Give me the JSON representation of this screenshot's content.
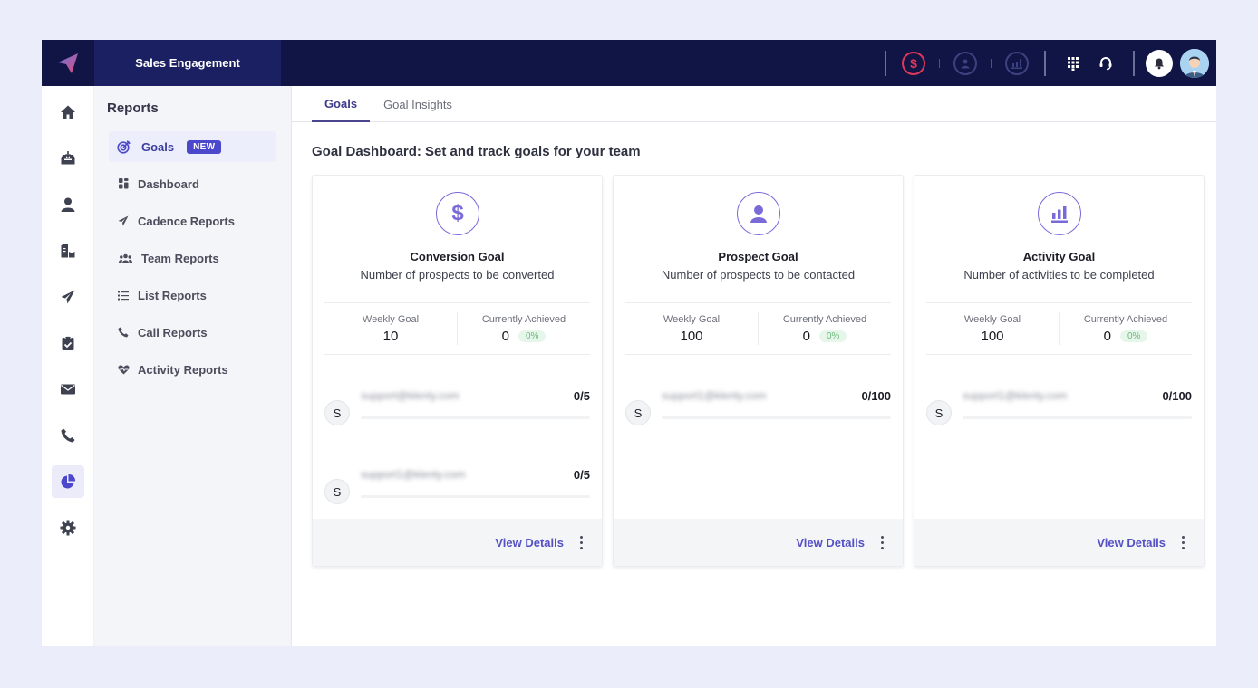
{
  "topbar": {
    "app_name": "Sales Engagement",
    "icons": [
      "conversion-goal-icon",
      "prospect-goal-icon",
      "activity-goal-icon",
      "dialpad-icon",
      "headset-icon",
      "bell-icon",
      "user-avatar"
    ]
  },
  "rail": {
    "items": [
      "home",
      "inbox",
      "prospects",
      "accounts",
      "cadences",
      "tasks",
      "email",
      "calls",
      "reports",
      "settings"
    ],
    "active": "reports"
  },
  "submenu": {
    "title": "Reports",
    "items": [
      {
        "label": "Goals",
        "badge": "NEW",
        "icon": "target-icon",
        "active": true
      },
      {
        "label": "Dashboard",
        "icon": "dashboard-icon"
      },
      {
        "label": "Cadence Reports",
        "icon": "paper-plane-icon"
      },
      {
        "label": "Team Reports",
        "icon": "team-icon"
      },
      {
        "label": "List Reports",
        "icon": "list-icon"
      },
      {
        "label": "Call Reports",
        "icon": "phone-icon"
      },
      {
        "label": "Activity Reports",
        "icon": "heartbeat-icon"
      }
    ]
  },
  "tabs": [
    {
      "label": "Goals",
      "active": true
    },
    {
      "label": "Goal Insights",
      "active": false
    }
  ],
  "page_title": "Goal Dashboard: Set and track goals for your team",
  "cards": [
    {
      "icon": "dollar-icon",
      "title": "Conversion Goal",
      "subtitle": "Number of prospects to be converted",
      "weekly_goal_label": "Weekly Goal",
      "weekly_goal": "10",
      "achieved_label": "Currently Achieved",
      "achieved": "0",
      "achieved_pct": "0%",
      "members": [
        {
          "initial": "S",
          "email": "support@klenty.com",
          "progress": "0/5"
        },
        {
          "initial": "S",
          "email": "support1@klenty.com",
          "progress": "0/5"
        }
      ],
      "view_details": "View Details"
    },
    {
      "icon": "user-icon",
      "title": "Prospect Goal",
      "subtitle": "Number of prospects to be contacted",
      "weekly_goal_label": "Weekly Goal",
      "weekly_goal": "100",
      "achieved_label": "Currently Achieved",
      "achieved": "0",
      "achieved_pct": "0%",
      "members": [
        {
          "initial": "S",
          "email": "support1@klenty.com",
          "progress": "0/100"
        }
      ],
      "view_details": "View Details"
    },
    {
      "icon": "bar-chart-icon",
      "title": "Activity Goal",
      "subtitle": "Number of activities to be completed",
      "weekly_goal_label": "Weekly Goal",
      "weekly_goal": "100",
      "achieved_label": "Currently Achieved",
      "achieved": "0",
      "achieved_pct": "0%",
      "members": [
        {
          "initial": "S",
          "email": "support1@klenty.com",
          "progress": "0/100"
        }
      ],
      "view_details": "View Details"
    }
  ],
  "colors": {
    "topbar": "#111546",
    "accent": "#5451c4",
    "goal_icon": "#7a6ad8",
    "conversion_icon": "#e0365a",
    "badge": "#4b48cc"
  }
}
